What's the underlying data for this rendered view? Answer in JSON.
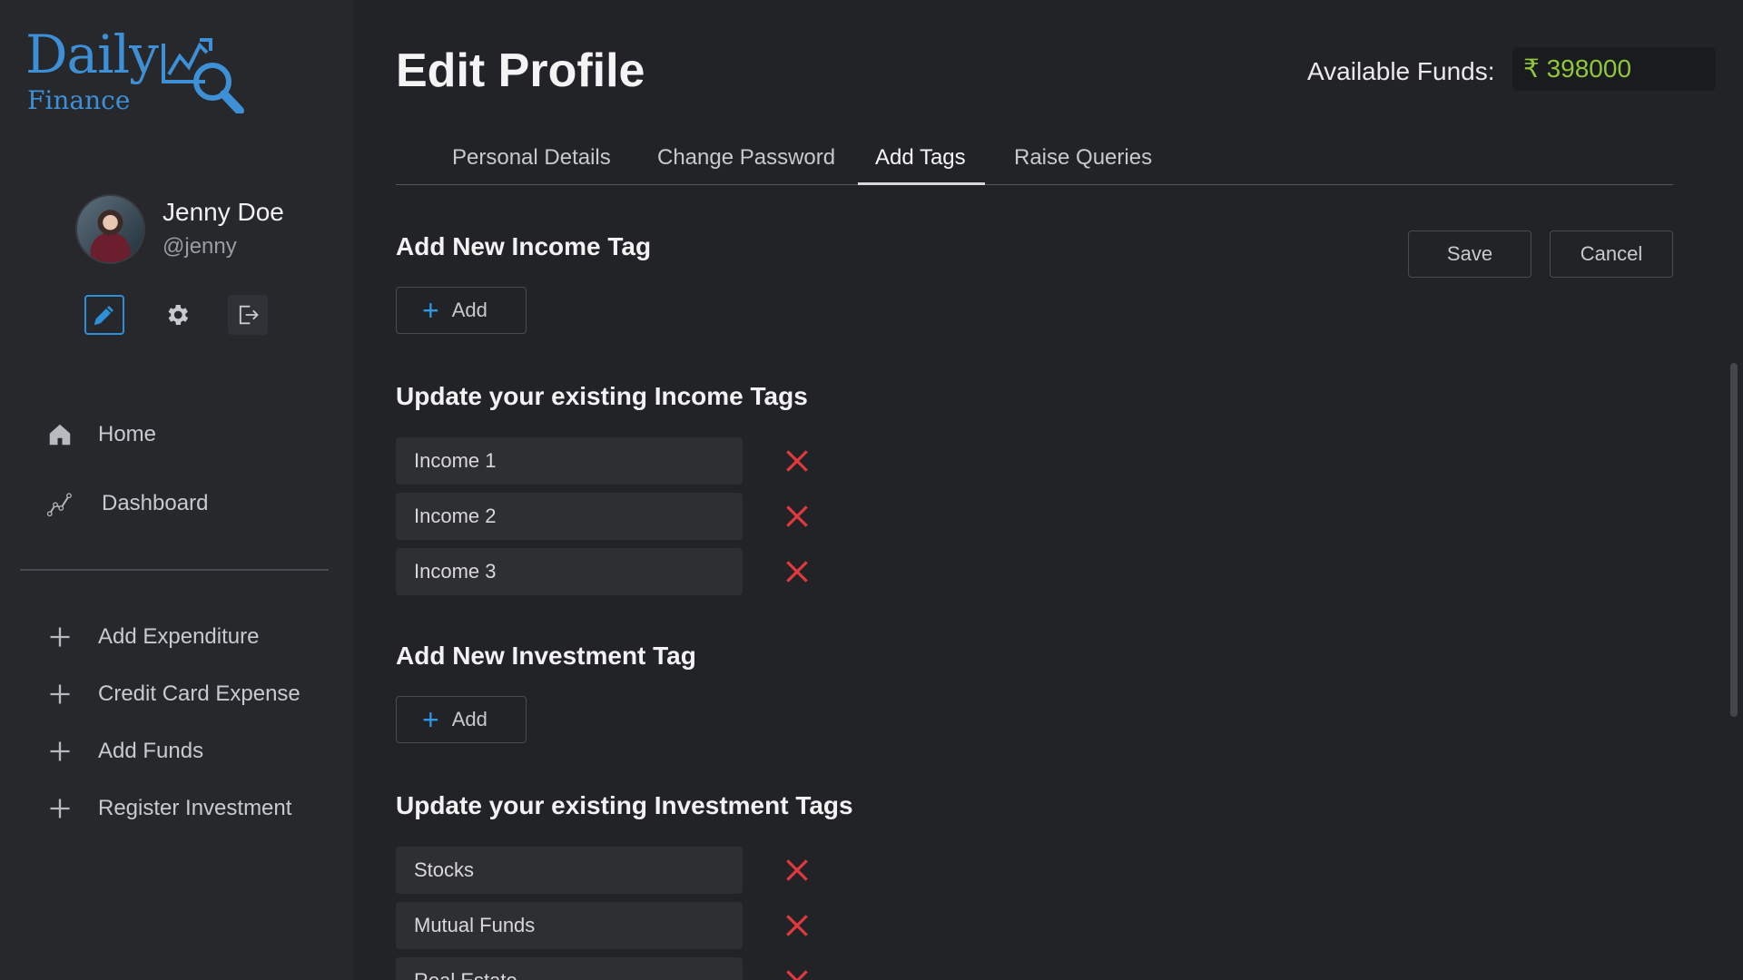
{
  "brand": {
    "name_top": "Daily",
    "name_bottom": "Finance",
    "color": "#3d8fd6"
  },
  "user": {
    "name": "Jenny Doe",
    "handle": "@jenny"
  },
  "quick_actions": [
    {
      "icon": "pencil-icon",
      "active": true
    },
    {
      "icon": "gear-icon",
      "active": false
    },
    {
      "icon": "logout-icon",
      "active": false
    }
  ],
  "nav": {
    "primary": [
      {
        "label": "Home",
        "icon": "home-icon"
      },
      {
        "label": "Dashboard",
        "icon": "chart-icon"
      }
    ],
    "actions": [
      {
        "label": "Add Expenditure",
        "icon": "plus-icon"
      },
      {
        "label": "Credit Card Expense",
        "icon": "plus-icon"
      },
      {
        "label": "Add Funds",
        "icon": "plus-icon"
      },
      {
        "label": "Register Investment",
        "icon": "plus-icon"
      }
    ]
  },
  "header": {
    "title": "Edit Profile",
    "funds_label": "Available Funds:",
    "funds_value": "₹ 398000",
    "funds_color": "#8fc63c"
  },
  "tabs": [
    {
      "label": "Personal Details",
      "active": false
    },
    {
      "label": "Change Password",
      "active": false
    },
    {
      "label": "Add Tags",
      "active": true
    },
    {
      "label": "Raise Queries",
      "active": false
    }
  ],
  "buttons": {
    "save": "Save",
    "cancel": "Cancel",
    "add": "Add"
  },
  "income": {
    "add_title": "Add New Income Tag",
    "update_title": "Update your existing Income Tags",
    "tags": [
      "Income 1",
      "Income 2",
      "Income 3"
    ]
  },
  "investment": {
    "add_title": "Add New Investment Tag",
    "update_title": "Update your existing Investment Tags",
    "tags": [
      "Stocks",
      "Mutual Funds",
      "Real Estate"
    ]
  },
  "colors": {
    "accent": "#2f97e0",
    "delete": "#e0393e"
  }
}
